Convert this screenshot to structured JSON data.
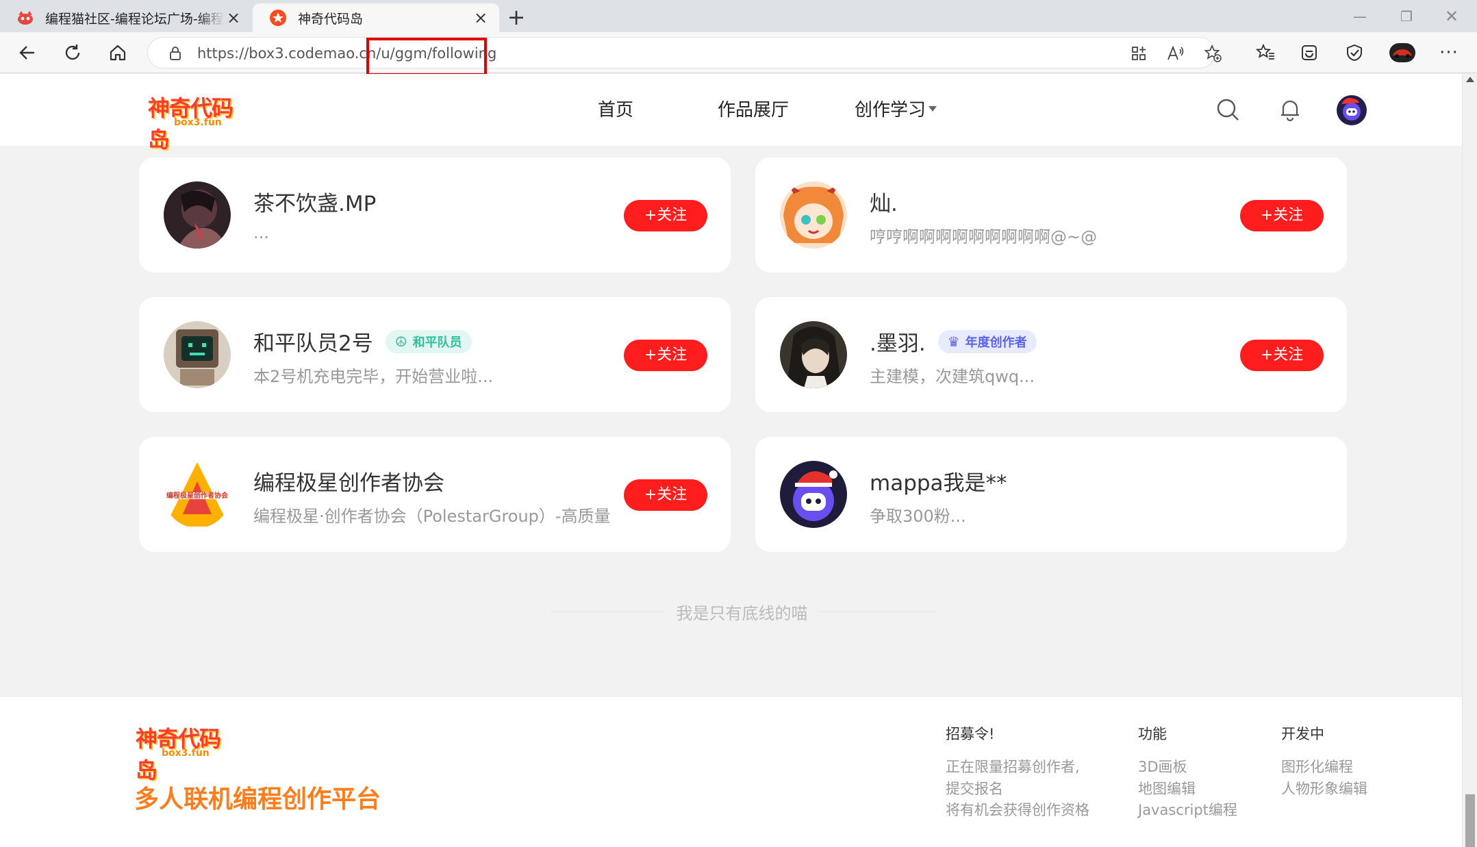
{
  "browser": {
    "tabs": [
      {
        "title": "编程猫社区-编程论坛广场-编程学",
        "active": false
      },
      {
        "title": "神奇代码岛",
        "active": true
      }
    ],
    "url": "https://box3.codemao.cn/u/ggm/following"
  },
  "site": {
    "logo": "神奇代码岛",
    "logo_sub": "box3.fun",
    "nav": [
      {
        "label": "首页"
      },
      {
        "label": "作品展厅"
      },
      {
        "label": "创作学习"
      }
    ]
  },
  "follow_list": [
    {
      "name": "茶不饮盏.MP",
      "bio": "...",
      "badge": null,
      "button": "+关注",
      "avatar_color": "#3a2a2e"
    },
    {
      "name": "灿.",
      "bio": "哼哼啊啊啊啊啊啊啊啊啊@~@",
      "badge": null,
      "button": "+关注",
      "avatar_color": "#f29a5a"
    },
    {
      "name": "和平队员2号",
      "bio": "本2号机充电完毕，开始营业啦...",
      "badge": "和平队员",
      "button": "+关注",
      "avatar_color": "#6b5a4a"
    },
    {
      "name": ".墨羽.",
      "bio": "主建模，次建筑qwq...",
      "badge": "年度创作者",
      "button": "+关注",
      "avatar_color": "#4a4038"
    },
    {
      "name": "编程极星创作者协会",
      "bio": "编程极星·创作者协会（PolestarGroup）-高质量",
      "badge": null,
      "button": "+关注",
      "avatar_color": "#fff2d6"
    },
    {
      "name": "mappa我是**",
      "bio": "争取300粉...",
      "badge": null,
      "button": null,
      "avatar_color": "#1f1f3a"
    }
  ],
  "avatar_text": "编程极星创作者协会",
  "bottom_text": "我是只有底线的喵",
  "footer": {
    "slogan": "多人联机编程创作平台",
    "columns": [
      {
        "title": "招募令!",
        "items": [
          "正在限量招募创作者,",
          "提交报名",
          "将有机会获得创作资格"
        ]
      },
      {
        "title": "功能",
        "items": [
          "3D画板",
          "地图编辑",
          "Javascript编程"
        ]
      },
      {
        "title": "开发中",
        "items": [
          "图形化编程",
          "人物形象编辑"
        ]
      }
    ]
  }
}
